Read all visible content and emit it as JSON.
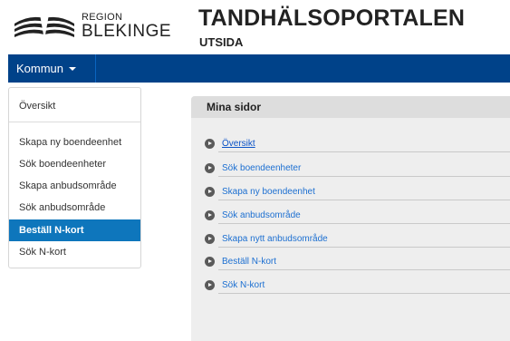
{
  "header": {
    "region_small": "REGION",
    "region_big": "BLEKINGE",
    "portal_title": "TANDHÄLSOPORTALEN",
    "portal_subtitle": "UTSIDA"
  },
  "navbar": {
    "menu_label": "Kommun",
    "bg_color": "#004289"
  },
  "sidebar": {
    "items": [
      {
        "label": "Översikt",
        "active": false
      },
      {
        "label": "Skapa ny boendeenhet",
        "active": false
      },
      {
        "label": "Sök boendeenheter",
        "active": false
      },
      {
        "label": "Skapa anbudsområde",
        "active": false
      },
      {
        "label": "Sök anbudsområde",
        "active": false
      },
      {
        "label": "Beställ N-kort",
        "active": true
      },
      {
        "label": "Sök N-kort",
        "active": false
      }
    ],
    "active_color": "#0e76bc"
  },
  "main": {
    "panel_title": "Mina sidor",
    "links": [
      {
        "label": "Översikt",
        "icon": "play-circle-icon"
      },
      {
        "label": "Sök boendeenheter",
        "icon": "play-circle-icon"
      },
      {
        "label": "Skapa ny boendeenhet",
        "icon": "play-circle-icon"
      },
      {
        "label": "Sök anbudsområde",
        "icon": "play-circle-icon"
      },
      {
        "label": "Skapa nytt anbudsområde",
        "icon": "play-circle-icon"
      },
      {
        "label": "Beställ N-kort",
        "icon": "play-circle-icon"
      },
      {
        "label": "Sök N-kort",
        "icon": "play-circle-icon"
      }
    ]
  }
}
